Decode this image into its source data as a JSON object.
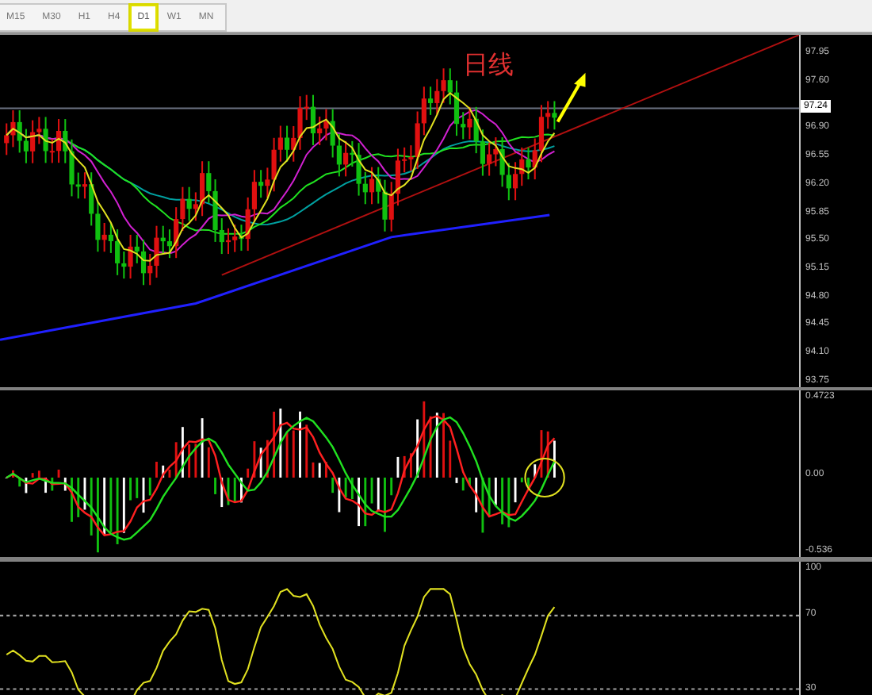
{
  "toolbar": {
    "timeframes": [
      {
        "label": "M15",
        "selected": false
      },
      {
        "label": "M30",
        "selected": false
      },
      {
        "label": "H1",
        "selected": false
      },
      {
        "label": "H4",
        "selected": false
      },
      {
        "label": "D1",
        "selected": true
      },
      {
        "label": "W1",
        "selected": false
      },
      {
        "label": "MN",
        "selected": false
      }
    ]
  },
  "main_chart": {
    "annotation": "日线",
    "price_axis": [
      "97.95",
      "97.60",
      "96.90",
      "96.55",
      "96.20",
      "95.85",
      "95.50",
      "95.15",
      "94.80",
      "94.45",
      "94.10",
      "93.75"
    ],
    "current_price": "97.24"
  },
  "macd_panel": {
    "axis": [
      "0.4723",
      "0.00",
      "-0.536"
    ]
  },
  "rsi_panel": {
    "axis": [
      "100",
      "70",
      "30"
    ]
  }
}
